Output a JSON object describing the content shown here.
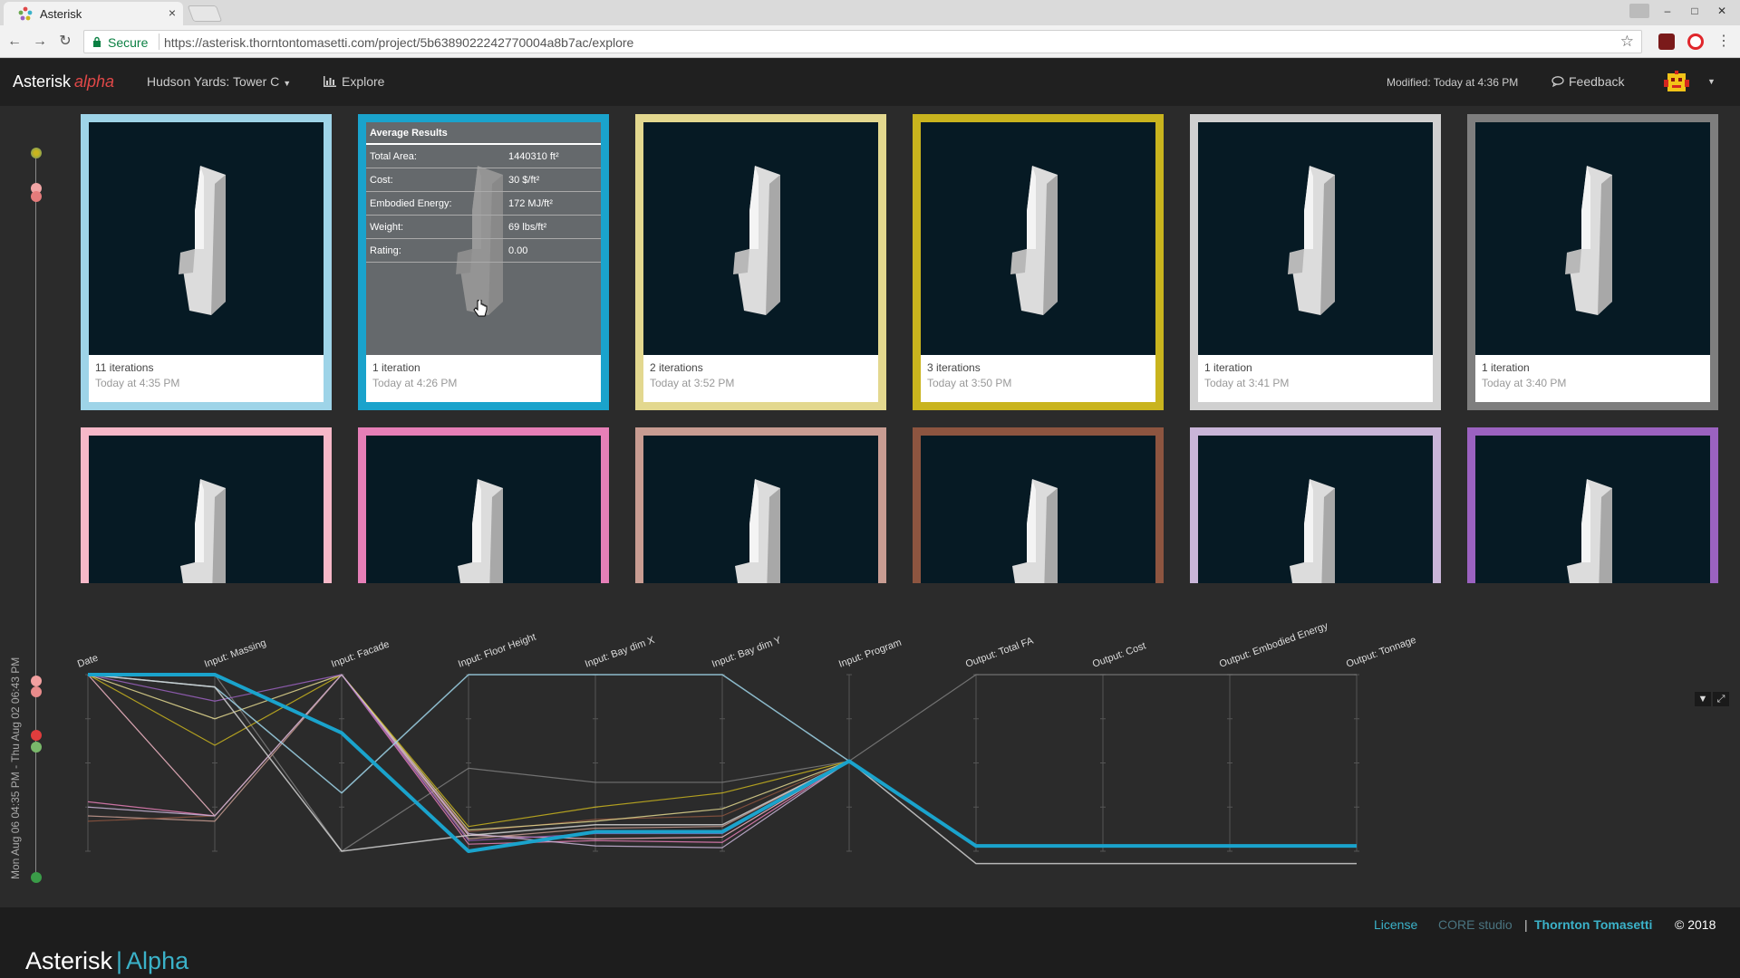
{
  "browser": {
    "tab_title": "Asterisk",
    "tab_close": "×",
    "secure_label": "Secure",
    "url": "https://asterisk.thorntontomasetti.com/project/5b6389022242770004a8b7ac/explore"
  },
  "header": {
    "brand": "Asterisk",
    "brand_alpha": "alpha",
    "project": "Hudson Yards: Tower C",
    "explore": "Explore",
    "modified": "Modified: Today at 4:36 PM",
    "feedback": "Feedback"
  },
  "timeline": {
    "label": "Mon Aug 06 04:35 PM - Thu Aug 02 06:43 PM"
  },
  "cards_row1": [
    {
      "iterations": "11 iterations",
      "date": "Today at 4:35 PM",
      "color": "#9ed4e8"
    },
    {
      "iterations": "1 iteration",
      "date": "Today at 4:26 PM",
      "color": "#1aa3cc"
    },
    {
      "iterations": "2 iterations",
      "date": "Today at 3:52 PM",
      "color": "#e3d88f"
    },
    {
      "iterations": "3 iterations",
      "date": "Today at 3:50 PM",
      "color": "#c9b41e"
    },
    {
      "iterations": "1 iteration",
      "date": "Today at 3:41 PM",
      "color": "#d0d0d0"
    },
    {
      "iterations": "1 iteration",
      "date": "Today at 3:40 PM",
      "color": "#7e7e7e"
    }
  ],
  "cards_row2": [
    {
      "color": "#f6b8c8"
    },
    {
      "color": "#e67fb7"
    },
    {
      "color": "#c89c92"
    },
    {
      "color": "#8d5540"
    },
    {
      "color": "#c9b5d8"
    },
    {
      "color": "#9b62c0"
    }
  ],
  "average_results": {
    "title": "Average Results",
    "rows": [
      {
        "label": "Total Area:",
        "value": "1440310 ft²"
      },
      {
        "label": "Cost:",
        "value": "30 $/ft²"
      },
      {
        "label": "Embodied Energy:",
        "value": "172 MJ/ft²"
      },
      {
        "label": "Weight:",
        "value": "69 lbs/ft²"
      },
      {
        "label": "Rating:",
        "value": "0.00"
      }
    ]
  },
  "chart_data": {
    "type": "line",
    "dimensions": [
      "Date",
      "Input: Massing",
      "Input: Facade",
      "Input: Floor Height",
      "Input: Bay dim X",
      "Input: Bay dim Y",
      "Input: Program",
      "Output: Total FA",
      "Output: Cost",
      "Output: Embodied Energy",
      "Output: Tonnage"
    ],
    "ylim": [
      0,
      1
    ],
    "series": [
      {
        "color": "#1aa3cc",
        "width": 4,
        "values": [
          1.0,
          1.0,
          0.67,
          0.0,
          0.11,
          0.11,
          0.51,
          0.03,
          0.03,
          0.03,
          0.03
        ]
      },
      {
        "color": "#9ed4e8",
        "width": 1.5,
        "values": [
          1.0,
          0.93,
          0.33,
          1.0,
          1.0,
          1.0,
          0.51,
          0.03,
          0.03,
          0.03,
          0.03
        ]
      },
      {
        "color": "#7e7e7e",
        "width": 1.2,
        "values": [
          1.0,
          1.0,
          0.0,
          0.47,
          0.39,
          0.39,
          0.51,
          1.0,
          1.0,
          1.0,
          1.0
        ]
      },
      {
        "color": "#d0d0d0",
        "width": 1.5,
        "values": [
          1.0,
          0.93,
          0.0,
          0.09,
          0.15,
          0.15,
          0.51,
          -0.07,
          -0.07,
          -0.07,
          -0.07
        ]
      },
      {
        "color": "#f6b8c8",
        "width": 1.2,
        "values": [
          1.0,
          0.2,
          1.0,
          0.09,
          0.07,
          0.08,
          0.51,
          0.03,
          0.03,
          0.03,
          0.03
        ]
      },
      {
        "color": "#e67fb7",
        "width": 1.2,
        "values": [
          0.28,
          0.2,
          1.0,
          0.04,
          0.06,
          0.05,
          0.51,
          0.03,
          0.03,
          0.03,
          0.03
        ]
      },
      {
        "color": "#c89c92",
        "width": 1.2,
        "values": [
          0.2,
          0.17,
          1.0,
          0.07,
          0.13,
          0.14,
          0.51,
          0.03,
          0.03,
          0.03,
          0.03
        ]
      },
      {
        "color": "#8d5540",
        "width": 1.2,
        "values": [
          0.17,
          0.2,
          1.0,
          0.11,
          0.18,
          0.2,
          0.51,
          0.03,
          0.03,
          0.03,
          0.03
        ]
      },
      {
        "color": "#c9b41e",
        "width": 1.2,
        "values": [
          1.0,
          0.6,
          1.0,
          0.14,
          0.25,
          0.33,
          0.51,
          0.03,
          0.03,
          0.03,
          0.03
        ]
      },
      {
        "color": "#e3d88f",
        "width": 1.2,
        "values": [
          1.0,
          0.75,
          1.0,
          0.12,
          0.17,
          0.24,
          0.51,
          0.03,
          0.03,
          0.03,
          0.03
        ]
      },
      {
        "color": "#9b62c0",
        "width": 1.2,
        "values": [
          1.0,
          0.85,
          1.0,
          0.06,
          0.1,
          0.1,
          0.51,
          0.03,
          0.03,
          0.03,
          0.03
        ]
      },
      {
        "color": "#c9b5d8",
        "width": 1.2,
        "values": [
          0.25,
          0.2,
          1.0,
          0.1,
          0.03,
          0.02,
          0.51,
          0.03,
          0.03,
          0.03,
          0.03
        ]
      }
    ]
  },
  "footer": {
    "license": "License",
    "core": "CORE studio",
    "pipe": "|",
    "tt": "Thornton Tomasetti",
    "copyright": "© 2018",
    "bottom_brand": "Asterisk",
    "bottom_sep": "|",
    "bottom_alpha": "Alpha"
  }
}
